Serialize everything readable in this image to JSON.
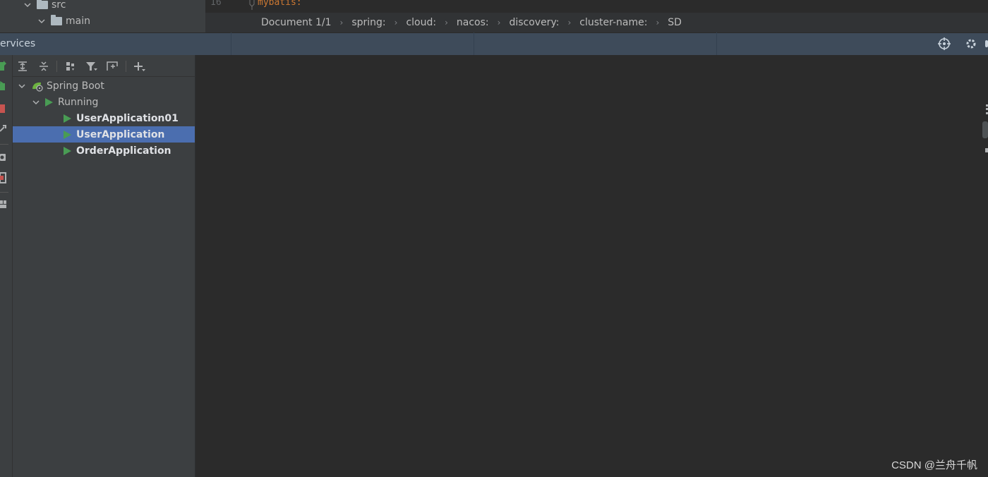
{
  "project_tree": {
    "items": [
      {
        "label": "src"
      },
      {
        "label": "main"
      }
    ]
  },
  "editor": {
    "line_number": "16",
    "code": "mybatis:"
  },
  "breadcrumb": [
    "Document 1/1",
    "spring:",
    "cloud:",
    "nacos:",
    "discovery:",
    "cluster-name:",
    "SD"
  ],
  "services": {
    "title": "ervices",
    "tree": {
      "root": "Spring Boot",
      "group": "Running",
      "apps": [
        "UserApplication01",
        "UserApplication",
        "OrderApplication"
      ],
      "selected_index": 1
    }
  },
  "watermark": "CSDN @兰舟千帆",
  "colors": {
    "run_green": "#499c54",
    "selection": "#4b6eaf",
    "keyword": "#cc7832",
    "stop_red": "#c75450"
  }
}
